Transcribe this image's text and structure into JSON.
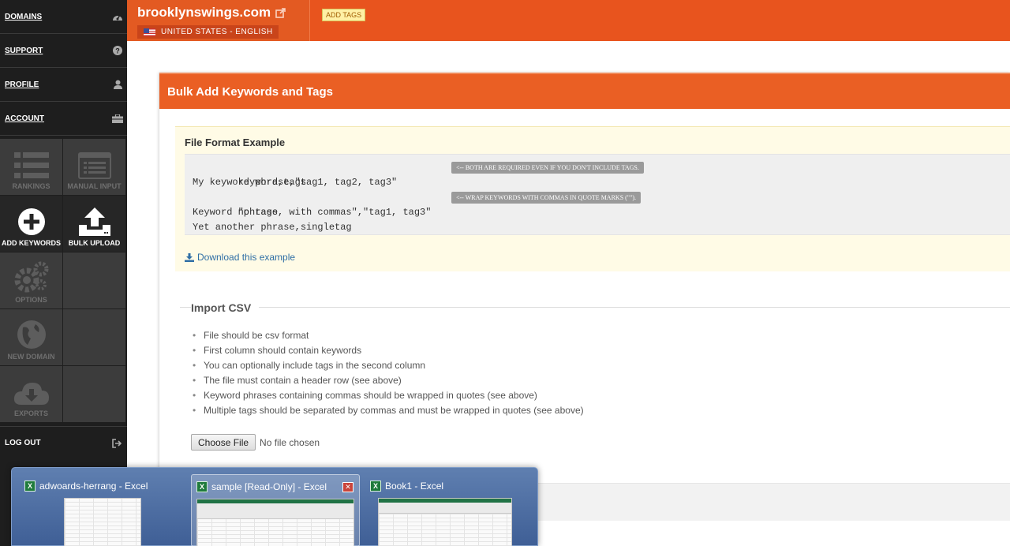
{
  "sidebar": {
    "nav": [
      {
        "label": "DOMAINS",
        "icon": "dashboard-icon"
      },
      {
        "label": "SUPPORT",
        "icon": "help-icon"
      },
      {
        "label": "PROFILE",
        "icon": "user-icon"
      },
      {
        "label": "ACCOUNT",
        "icon": "briefcase-icon"
      }
    ],
    "tiles": {
      "rankings": "RANKINGS",
      "manual_input": "MANUAL INPUT",
      "add_keywords": "ADD KEYWORDS",
      "bulk_upload": "BULK UPLOAD",
      "options": "OPTIONS",
      "new_domain": "NEW DOMAIN",
      "exports": "EXPORTS"
    },
    "logout": "LOG OUT"
  },
  "header": {
    "site": "brooklynswings.com",
    "locale": "UNITED STATES - ENGLISH",
    "add_tags": "ADD TAGS",
    "accent": "#e8541e"
  },
  "panel": {
    "title": "Bulk Add Keywords and Tags",
    "format_title": "File Format Example",
    "code_lines": [
      "keyword,tags",
      "My keyword phrase,\"tag1, tag2, tag3\"",
      "\"phrase, with commas\",\"tag1, tag3\"",
      "Keyword no tags",
      "Yet another phrase,singletag"
    ],
    "notes": {
      "line0": "<-- BOTH ARE REQUIRED EVEN IF YOU DON'T INCLUDE TAGS.",
      "line2": "<-- WRAP KEYWORDS WITH COMMAS IN QUOTE MARKS (\"\")."
    },
    "download_label": "Download this example",
    "import_title": "Import CSV",
    "rules": [
      "File should be csv format",
      "First column should contain keywords",
      "You can optionally include tags in the second column",
      "The file must contain a header row (see above)",
      "Keyword phrases containing commas should be wrapped in quotes (see above)",
      "Multiple tags should be separated by commas and must be wrapped in quotes (see above)"
    ],
    "choose_file": "Choose File",
    "no_file": "No file chosen"
  },
  "taskbar": {
    "windows": [
      {
        "title": "adwoards-herrang - Excel"
      },
      {
        "title": "sample  [Read-Only] - Excel"
      },
      {
        "title": "Book1 - Excel"
      }
    ],
    "excel_glyph": "X"
  }
}
